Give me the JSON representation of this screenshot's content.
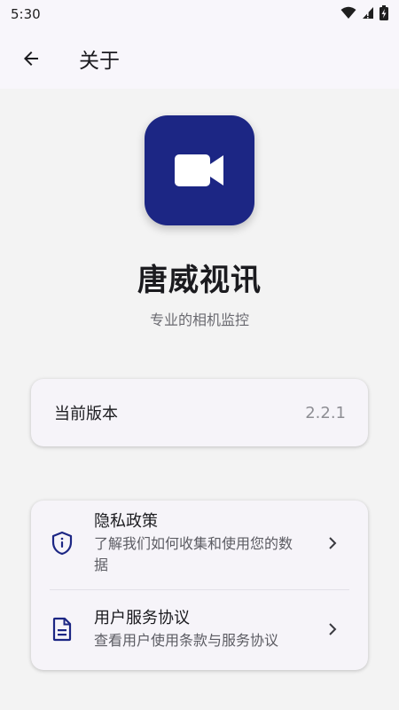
{
  "status_bar": {
    "time": "5:30",
    "icons": [
      "wifi-icon",
      "signal-icon",
      "battery-icon"
    ]
  },
  "app_bar": {
    "back_icon": "arrow-back-icon",
    "title": "关于"
  },
  "app_info": {
    "icon": "videocam-icon",
    "icon_bg_color": "#1c2684",
    "name": "唐威视讯",
    "description": "专业的相机监控"
  },
  "version": {
    "label": "当前版本",
    "value": "2.2.1"
  },
  "links": [
    {
      "icon": "shield-info-icon",
      "title": "隐私政策",
      "subtitle": "了解我们如何收集和使用您的数据"
    },
    {
      "icon": "document-icon",
      "title": "用户服务协议",
      "subtitle": "查看用户使用条款与服务协议"
    }
  ],
  "colors": {
    "accent": "#1c2684",
    "background": "#f3f3f3",
    "card": "#f6f4f9"
  }
}
